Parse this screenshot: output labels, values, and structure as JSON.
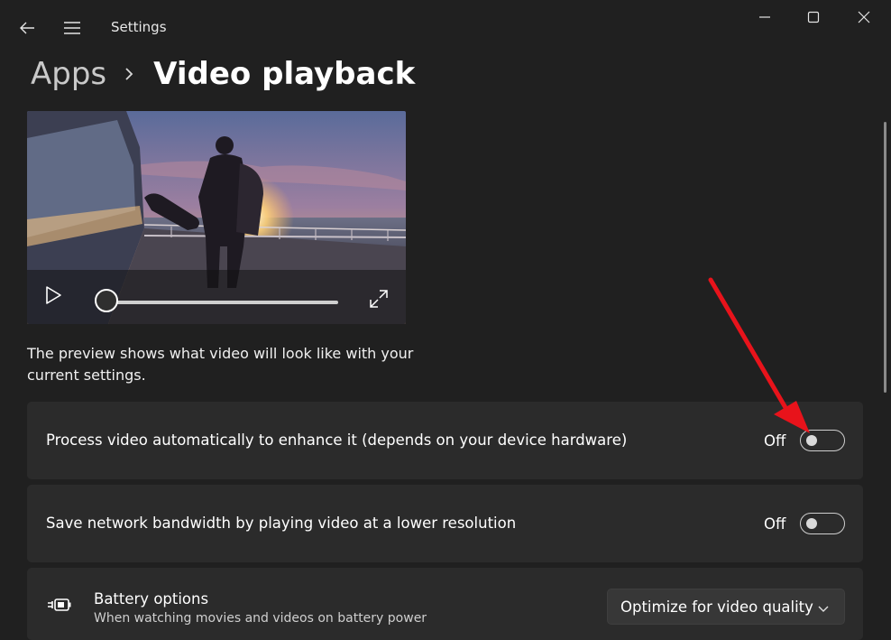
{
  "window": {
    "app_title": "Settings",
    "back_icon": "arrow-left-icon",
    "menu_icon": "hamburger-menu-icon",
    "minimize_icon": "minimize-icon",
    "maximize_icon": "maximize-icon",
    "close_icon": "close-icon"
  },
  "breadcrumb": {
    "parent": "Apps",
    "separator_icon": "chevron-right-icon",
    "current": "Video playback"
  },
  "preview": {
    "play_icon": "play-icon",
    "fullscreen_icon": "fullscreen-icon",
    "seek_position": 0,
    "description": "The preview shows what video will look like with your current settings."
  },
  "settings": {
    "process_video": {
      "label": "Process video automatically to enhance it (depends on your device hardware)",
      "state_label": "Off",
      "enabled": false
    },
    "save_bandwidth": {
      "label": "Save network bandwidth by playing video at a lower resolution",
      "state_label": "Off",
      "enabled": false
    },
    "battery_options": {
      "icon": "battery-plug-icon",
      "title": "Battery options",
      "subtitle": "When watching movies and videos on battery power",
      "selected": "Optimize for video quality",
      "chevron_icon": "chevron-down-icon"
    }
  },
  "annotation": {
    "arrow_color": "#e8131b"
  },
  "colors": {
    "background": "#202020",
    "card": "#2b2b2b"
  }
}
